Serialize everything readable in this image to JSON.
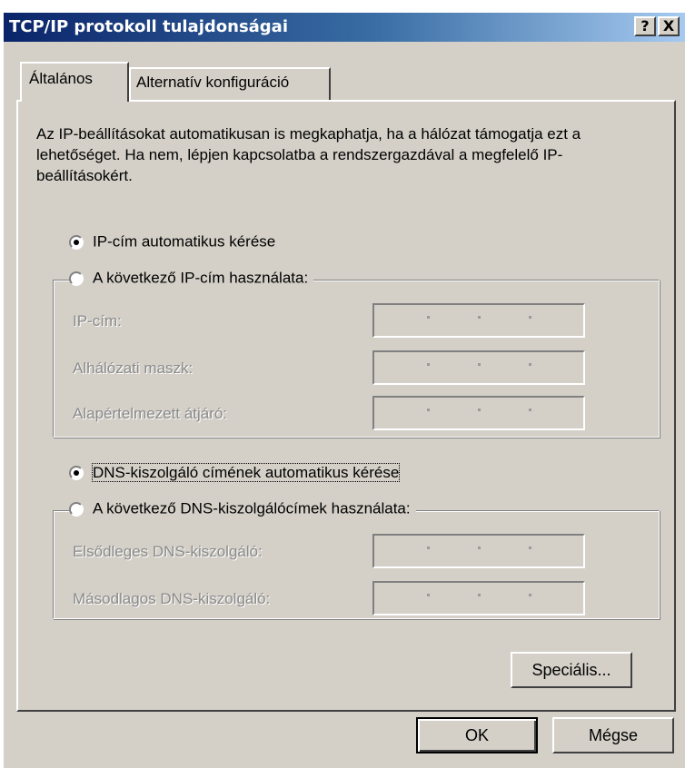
{
  "window": {
    "title": "TCP/IP protokoll tulajdonságai",
    "help_button": "?",
    "close_button": "X"
  },
  "tabs": [
    {
      "label": "Általános",
      "active": true
    },
    {
      "label": "Alternatív konfiguráció",
      "active": false
    }
  ],
  "description": "Az IP-beállításokat automatikusan is megkaphatja, ha a hálózat támogatja ezt a lehetőséget. Ha nem, lépjen kapcsolatba a rendszergazdával a megfelelő IP-beállításokért.",
  "ip": {
    "auto_label": "IP-cím automatikus kérése",
    "auto_selected": true,
    "manual_label": "A következő IP-cím használata:",
    "fields": [
      {
        "label": "IP-cím:",
        "value": ". . ."
      },
      {
        "label": "Alhálózati maszk:",
        "value": ". . ."
      },
      {
        "label": "Alapértelmezett átjáró:",
        "value": ". . ."
      }
    ]
  },
  "dns": {
    "auto_label": "DNS-kiszolgáló címének automatikus kérése",
    "auto_selected": true,
    "manual_label": "A következő DNS-kiszolgálócímek használata:",
    "fields": [
      {
        "label": "Elsődleges DNS-kiszolgáló:",
        "value": ". . ."
      },
      {
        "label": "Másodlagos DNS-kiszolgáló:",
        "value": ". . ."
      }
    ]
  },
  "buttons": {
    "advanced": "Speciális...",
    "ok": "OK",
    "cancel": "Mégse"
  },
  "icons": [
    "help-icon",
    "close-icon"
  ]
}
